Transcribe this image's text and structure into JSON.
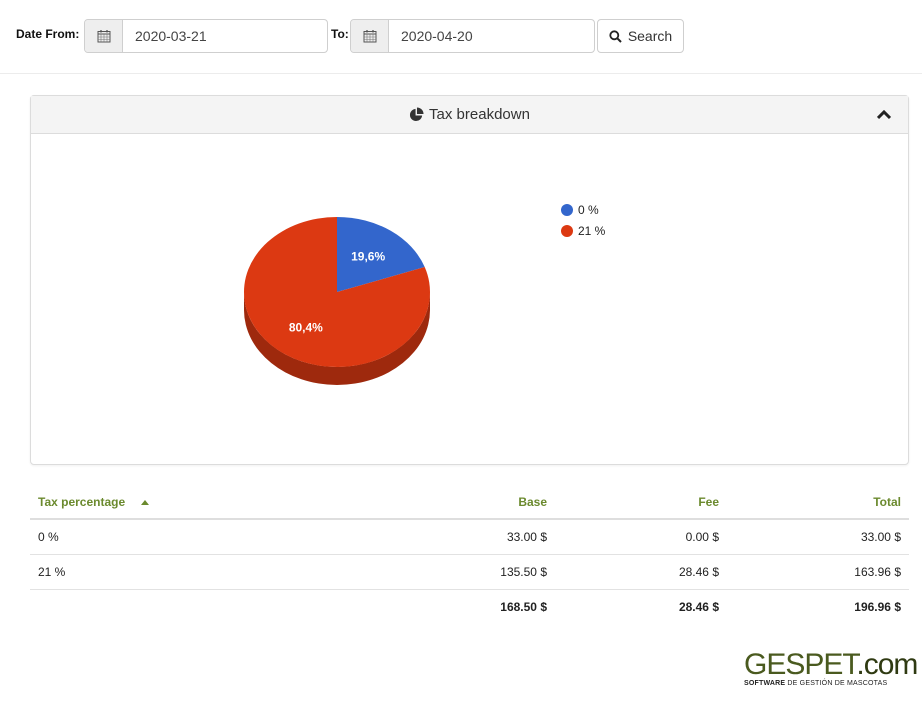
{
  "filters": {
    "date_from_label": "Date From:",
    "date_from_value": "2020-03-21",
    "date_to_label": "To:",
    "date_to_value": "2020-04-20",
    "calendar_icon": "calendar-icon",
    "search_icon": "search-icon",
    "search_label": "Search"
  },
  "panel": {
    "title": "Tax breakdown",
    "title_icon": "pie-chart-icon",
    "collapse_icon": "chevron-up-icon"
  },
  "chart_data": {
    "type": "pie",
    "title": "Tax breakdown",
    "categories": [
      "0 %",
      "21 %"
    ],
    "values": [
      19.6,
      80.4
    ],
    "labels": [
      "19,6%",
      "80,4%"
    ],
    "colors": [
      "#3366cc",
      "#dc3912"
    ],
    "legend_position": "right",
    "style": "3d"
  },
  "table": {
    "headers": {
      "tax_percentage": "Tax percentage",
      "base": "Base",
      "fee": "Fee",
      "total": "Total"
    },
    "sort_column": "tax_percentage",
    "sort_direction": "asc",
    "rows": [
      {
        "tax": "0 %",
        "base": "33.00 $",
        "fee": "0.00 $",
        "total": "33.00 $"
      },
      {
        "tax": "21 %",
        "base": "135.50 $",
        "fee": "28.46 $",
        "total": "163.96 $"
      }
    ],
    "totals": {
      "tax": "",
      "base": "168.50 $",
      "fee": "28.46 $",
      "total": "196.96 $"
    }
  },
  "logo": {
    "brand_main": "GESPET",
    "brand_suffix": ".com",
    "tagline_bold": "SOFTWARE",
    "tagline_rest": " DE GESTIÓN DE MASCOTAS"
  }
}
